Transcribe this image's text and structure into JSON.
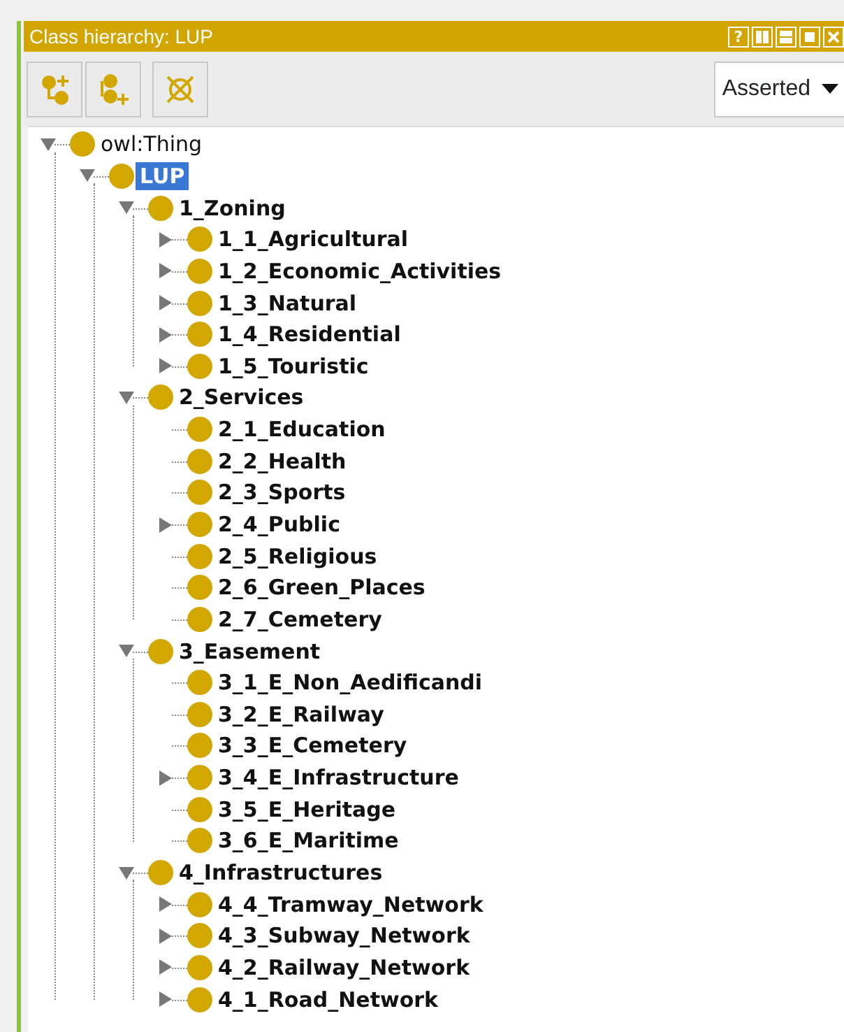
{
  "window": {
    "title": "Class hierarchy: LUP",
    "controls": [
      {
        "kind": "help",
        "label": "?"
      },
      {
        "kind": "split-v"
      },
      {
        "kind": "split-h"
      },
      {
        "kind": "maximize"
      },
      {
        "kind": "close"
      }
    ]
  },
  "toolbar": {
    "buttons": [
      {
        "kind": "add-subclass"
      },
      {
        "kind": "add-sibling"
      },
      {
        "kind": "delete"
      }
    ],
    "view_select": {
      "value": "Asserted"
    }
  },
  "tree": [
    {
      "label": "owl:Thing",
      "bold": false,
      "selected": false,
      "expanded": true,
      "children": [
        {
          "label": "LUP",
          "bold": true,
          "selected": true,
          "expanded": true,
          "children": [
            {
              "label": "1_Zoning",
              "bold": true,
              "selected": false,
              "expanded": true,
              "children": [
                {
                  "label": "1_1_Agricultural",
                  "bold": true,
                  "selected": false,
                  "expanded": false
                },
                {
                  "label": "1_2_Economic_Activities",
                  "bold": true,
                  "selected": false,
                  "expanded": false
                },
                {
                  "label": "1_3_Natural",
                  "bold": true,
                  "selected": false,
                  "expanded": false
                },
                {
                  "label": "1_4_Residential",
                  "bold": true,
                  "selected": false,
                  "expanded": false
                },
                {
                  "label": "1_5_Touristic",
                  "bold": true,
                  "selected": false,
                  "expanded": false
                }
              ]
            },
            {
              "label": "2_Services",
              "bold": true,
              "selected": false,
              "expanded": true,
              "children": [
                {
                  "label": "2_1_Education",
                  "bold": true,
                  "selected": false
                },
                {
                  "label": "2_2_Health",
                  "bold": true,
                  "selected": false
                },
                {
                  "label": "2_3_Sports",
                  "bold": true,
                  "selected": false
                },
                {
                  "label": "2_4_Public",
                  "bold": true,
                  "selected": false,
                  "expanded": false
                },
                {
                  "label": "2_5_Religious",
                  "bold": true,
                  "selected": false
                },
                {
                  "label": "2_6_Green_Places",
                  "bold": true,
                  "selected": false
                },
                {
                  "label": "2_7_Cemetery",
                  "bold": true,
                  "selected": false
                }
              ]
            },
            {
              "label": "3_Easement",
              "bold": true,
              "selected": false,
              "expanded": true,
              "children": [
                {
                  "label": "3_1_E_Non_Aedificandi",
                  "bold": true,
                  "selected": false
                },
                {
                  "label": "3_2_E_Railway",
                  "bold": true,
                  "selected": false
                },
                {
                  "label": "3_3_E_Cemetery",
                  "bold": true,
                  "selected": false
                },
                {
                  "label": "3_4_E_Infrastructure",
                  "bold": true,
                  "selected": false,
                  "expanded": false
                },
                {
                  "label": "3_5_E_Heritage",
                  "bold": true,
                  "selected": false
                },
                {
                  "label": "3_6_E_Maritime",
                  "bold": true,
                  "selected": false
                }
              ]
            },
            {
              "label": "4_Infrastructures",
              "bold": true,
              "selected": false,
              "expanded": true,
              "children": [
                {
                  "label": "4_4_Tramway_Network",
                  "bold": true,
                  "selected": false,
                  "expanded": false
                },
                {
                  "label": "4_3_Subway_Network",
                  "bold": true,
                  "selected": false,
                  "expanded": false
                },
                {
                  "label": "4_2_Railway_Network",
                  "bold": true,
                  "selected": false,
                  "expanded": false
                },
                {
                  "label": "4_1_Road_Network",
                  "bold": true,
                  "selected": false,
                  "expanded": false
                }
              ]
            }
          ]
        }
      ]
    }
  ]
}
